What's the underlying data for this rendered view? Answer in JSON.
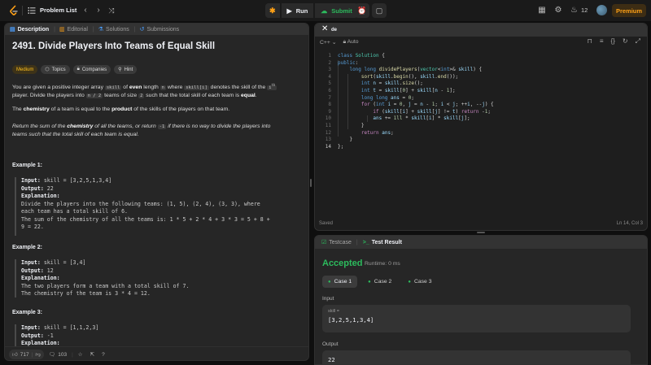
{
  "topbar": {
    "problem_list_label": "Problem List",
    "run_label": "Run",
    "submit_label": "Submit",
    "streak_count": "12",
    "premium_label": "Premium"
  },
  "left_tabs": {
    "description": "Description",
    "editorial": "Editorial",
    "solutions": "Solutions",
    "submissions": "Submissions"
  },
  "problem": {
    "title": "2491. Divide Players Into Teams of Equal Skill",
    "tags": {
      "difficulty": "Medium",
      "topics": "Topics",
      "companies": "Companies",
      "hint": "Hint"
    },
    "p1": {
      "a": "You are given a positive integer array ",
      "c1": "skill",
      "b": " of ",
      "b_even": "even",
      "c": " length ",
      "c2": "n",
      "d": " where ",
      "c3": "skill[i]",
      "e": " denotes the skill of the ",
      "c4": "i",
      "c4_sup": "th",
      "f": "player. Divide the players into ",
      "c5": "n / 2",
      "g": " teams of size ",
      "c6": "2",
      "h": " such that the total skill of each team is ",
      "h_equal": "equal",
      "i": "."
    },
    "p2": {
      "a": "The ",
      "b": "chemistry",
      "c": " of a team is equal to the ",
      "d": "product",
      "e": " of the skills of the players on that team."
    },
    "p3": {
      "a": "Return the sum of the ",
      "b": "chemistry",
      "c": " of all the teams, or return ",
      "code": "-1",
      "d": " if there is no way to divide the players into",
      "e": "teams such that the total skill of each team is equal."
    },
    "examples": [
      {
        "title": "Example 1:",
        "input_label": "Input:",
        "input": "skill = [3,2,5,1,3,4]",
        "output_label": "Output:",
        "output": "22",
        "expl_label": "Explanation:",
        "expl": [
          "Divide the players into the following teams: (1, 5), (2, 4), (3, 3), where",
          "each team has a total skill of 6.",
          "The sum of the chemistry of all the teams is: 1 * 5 + 2 * 4 + 3 * 3 = 5 + 8 +",
          "9 = 22."
        ]
      },
      {
        "title": "Example 2:",
        "input_label": "Input:",
        "input": "skill = [3,4]",
        "output_label": "Output:",
        "output": "12",
        "expl_label": "Explanation:",
        "expl": [
          "The two players form a team with a total skill of 7.",
          "The chemistry of the team is 3 * 4 = 12."
        ]
      },
      {
        "title": "Example 3:",
        "input_label": "Input:",
        "input": "skill = [1,1,2,3]",
        "output_label": "Output:",
        "output": "-1",
        "expl_label": "Explanation:"
      }
    ]
  },
  "left_bottom": {
    "likes": "717",
    "comments": "103"
  },
  "code_panel": {
    "tab_label": "de",
    "language": "C++",
    "mode": "Auto",
    "status_left": "Saved",
    "status_right": "Ln 14, Col 3",
    "line_numbers": [
      "1",
      "2",
      "3",
      "4",
      "5",
      "6",
      "7",
      "8",
      "9",
      "10",
      "11",
      "12",
      "13",
      "14"
    ]
  },
  "result_panel": {
    "tab_testcase": "Testcase",
    "tab_result": "Test Result",
    "status": "Accepted",
    "runtime": "Runtime: 0 ms",
    "cases": [
      "Case 1",
      "Case 2",
      "Case 3"
    ],
    "input_label": "Input",
    "var_name": "skill =",
    "input_value": "[3,2,5,1,3,4]",
    "output_label": "Output",
    "output_value": "22"
  },
  "colors": {
    "accent_green": "#2cbb5d",
    "premium": "#ffa116",
    "medium": "#ffc01e"
  }
}
